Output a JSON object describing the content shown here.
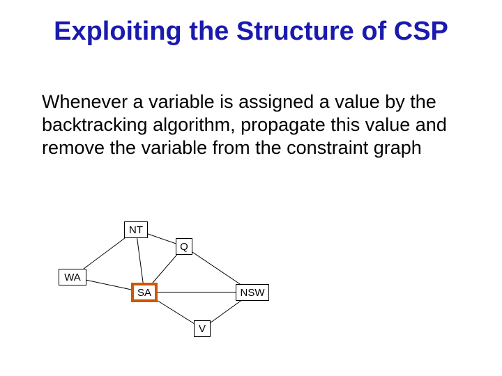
{
  "title": "Exploiting the Structure of CSP",
  "body": "Whenever a variable is assigned a value by the backtracking algorithm, propagate this value and remove the variable from the constraint graph",
  "graph": {
    "nodes": {
      "nt": {
        "label": "NT"
      },
      "q": {
        "label": "Q"
      },
      "wa": {
        "label": "WA"
      },
      "sa": {
        "label": "SA"
      },
      "nsw": {
        "label": "NSW"
      },
      "v": {
        "label": "V"
      }
    },
    "highlighted_node": "sa",
    "edges": [
      [
        "wa",
        "nt"
      ],
      [
        "wa",
        "sa"
      ],
      [
        "nt",
        "sa"
      ],
      [
        "nt",
        "q"
      ],
      [
        "sa",
        "q"
      ],
      [
        "sa",
        "nsw"
      ],
      [
        "sa",
        "v"
      ],
      [
        "q",
        "nsw"
      ],
      [
        "nsw",
        "v"
      ]
    ]
  }
}
